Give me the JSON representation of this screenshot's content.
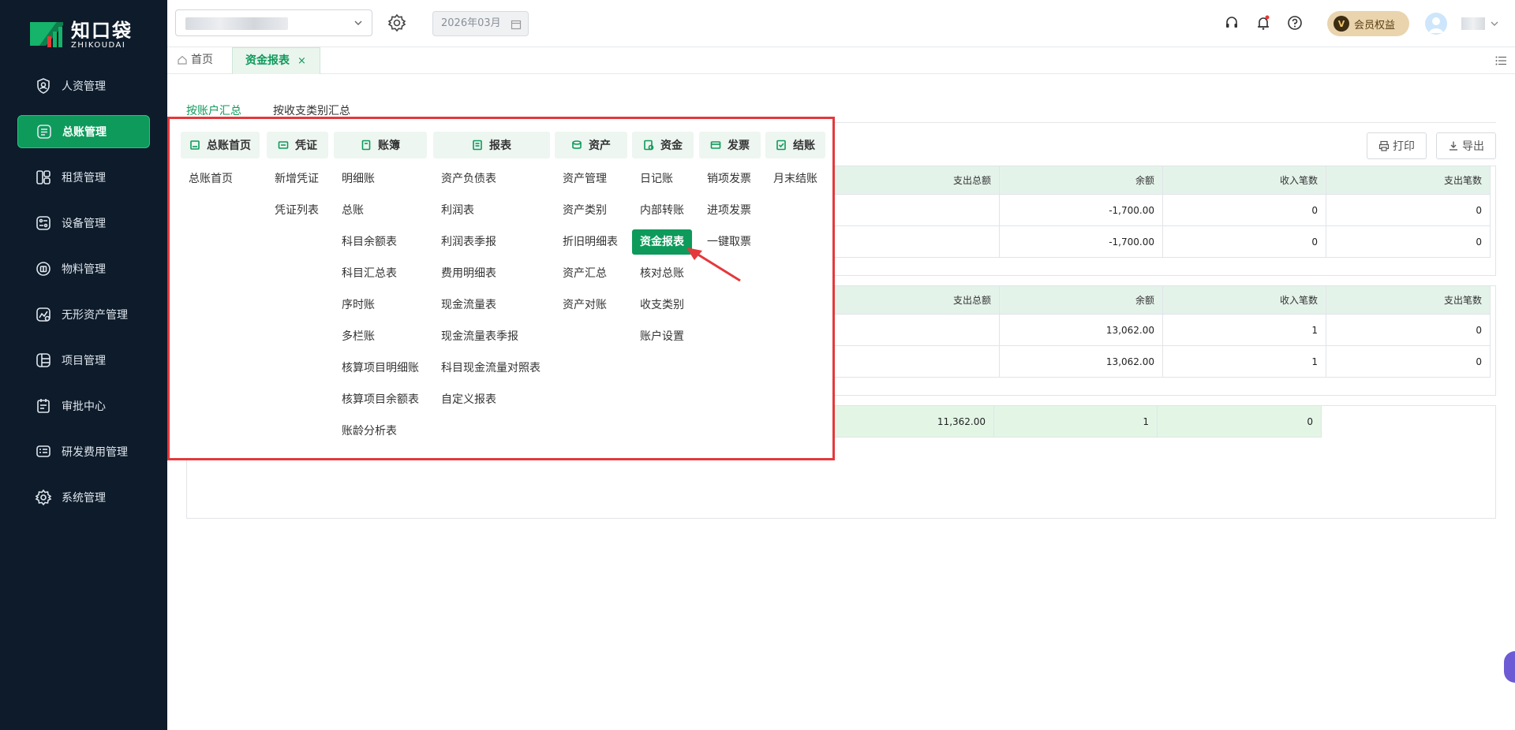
{
  "brand": {
    "name_cn": "知口袋",
    "name_en": "ZHIKOUDAI"
  },
  "sidebar": {
    "items": [
      {
        "label": "人资管理",
        "icon": "person-shield-icon",
        "active": false
      },
      {
        "label": "总账管理",
        "icon": "ledger-icon",
        "active": true
      },
      {
        "label": "租赁管理",
        "icon": "rental-icon",
        "active": false
      },
      {
        "label": "设备管理",
        "icon": "device-icon",
        "active": false
      },
      {
        "label": "物料管理",
        "icon": "material-icon",
        "active": false
      },
      {
        "label": "无形资产管理",
        "icon": "intangible-asset-icon",
        "active": false
      },
      {
        "label": "项目管理",
        "icon": "project-icon",
        "active": false
      },
      {
        "label": "审批中心",
        "icon": "approval-icon",
        "active": false
      },
      {
        "label": "研发费用管理",
        "icon": "rd-expense-icon",
        "active": false
      },
      {
        "label": "系统管理",
        "icon": "gear-icon",
        "active": false
      }
    ]
  },
  "topbar": {
    "period": "2026年03月",
    "vip_label": "会员权益",
    "vip_badge": "V"
  },
  "tabs": [
    {
      "label": "首页",
      "active": false
    },
    {
      "label": "资金报表",
      "active": true,
      "close": "×"
    }
  ],
  "subtabs": [
    "按账户汇总",
    "按收支类别汇总"
  ],
  "actions": {
    "print": "打印",
    "export": "导出"
  },
  "table1": {
    "headers": [
      "支出总额",
      "余额",
      "收入笔数",
      "支出笔数"
    ],
    "rows": [
      [
        "",
        "-1,700.00",
        "0",
        "0"
      ],
      [
        "",
        "-1,700.00",
        "0",
        "0"
      ]
    ]
  },
  "table2": {
    "headers": [
      "支出总额",
      "余额",
      "收入笔数",
      "支出笔数"
    ],
    "rows": [
      [
        "",
        "13,062.00",
        "1",
        "0"
      ],
      [
        "",
        "13,062.00",
        "1",
        "0"
      ]
    ]
  },
  "total_row": [
    "",
    "11,362.00",
    "1",
    "0"
  ],
  "menu": {
    "columns": [
      {
        "title": "总账首页",
        "items": [
          "总账首页"
        ]
      },
      {
        "title": "凭证",
        "items": [
          "新增凭证",
          "凭证列表"
        ]
      },
      {
        "title": "账簿",
        "items": [
          "明细账",
          "总账",
          "科目余额表",
          "科目汇总表",
          "序时账",
          "多栏账",
          "核算项目明细账",
          "核算项目余额表",
          "账龄分析表"
        ]
      },
      {
        "title": "报表",
        "items": [
          "资产负债表",
          "利润表",
          "利润表季报",
          "费用明细表",
          "现金流量表",
          "现金流量表季报",
          "科目现金流量对照表",
          "自定义报表"
        ]
      },
      {
        "title": "资产",
        "items": [
          "资产管理",
          "资产类别",
          "折旧明细表",
          "资产汇总",
          "资产对账"
        ]
      },
      {
        "title": "资金",
        "items": [
          "日记账",
          "内部转账",
          "资金报表",
          "核对总账",
          "收支类别",
          "账户设置"
        ]
      },
      {
        "title": "发票",
        "items": [
          "销项发票",
          "进项发票",
          "一键取票"
        ]
      },
      {
        "title": "结账",
        "items": [
          "月末结账"
        ]
      }
    ],
    "highlighted": "资金报表"
  },
  "colors": {
    "accent": "#0e9a5b",
    "sidebar_bg": "#0d1b2a",
    "highlight_border": "#e5383b"
  }
}
